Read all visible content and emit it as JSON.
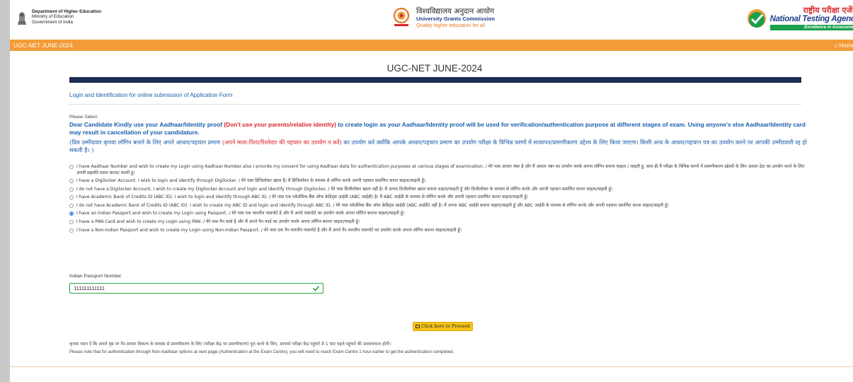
{
  "header": {
    "moe": {
      "line1": "Department of Higher Education",
      "line2": "Ministry of Education",
      "line3": "Government of India"
    },
    "ugc": {
      "hindi": "विश्वविद्यालय अनुदान आयोग",
      "english": "University Grants Commission",
      "tagline": "Quality higher education for all"
    },
    "nta": {
      "hindi": "राष्ट्रीय परीक्षा एजेंसी",
      "english": "National Testing Agency",
      "tagline": "Excellence in Assessment"
    }
  },
  "navbar": {
    "title": "UGC-NET JUNE-2024",
    "home_label": "Home",
    "bg_color": "#f39c37"
  },
  "page": {
    "title": "UGC-NET JUNE-2024",
    "section_heading": "Login and Identification for online submission of Application Form",
    "please_select": "Please Select:",
    "warning_en_1": "Dear Candidate Kindly use your Aadhaar/Identity proof",
    "warning_en_red": "(Don't use your parents/relative identity)",
    "warning_en_2": "to create login as your Aadhaar/Identity proof will be used for verification/authentication purpose at different stages of exam. Using anyone's else Aadhaar/Identity card may result in cancellation of your candidature.",
    "warning_hi_1": "(प्रिय उम्मीदवार कृपया लॉगिन बनाने के लिए अपने आधार/पहचान प्रमाण",
    "warning_hi_red": "(अपने माता-पिता/रिश्तेदार की पहचान का उपयोग न करें)",
    "warning_hi_2": "का उपयोग करें क्योंकि आपके आधार/पहचान प्रमाण का उपयोग परीक्षा के विभिन्न चरणों में सत्यापन/प्रमाणीकरण उद्देश्य के लिए किया जाएगा। किसी अन्य के आधार/पहचान पत्र का उपयोग करने पर आपकी उम्मीदवारी रद्द हो सकती है। )"
  },
  "options": [
    {
      "label": "I have Aadhaar Number and wish to create my Login using Aadhaar Number,also I provide my consent for using Aadhaar data for authentication purposes at various stages of examination. / मेरे पास आधार नंबर है और मैं आधार नंबर का उपयोग करके अपना लॉगिन बनाना चाहता / चाहती हूं, साथ ही मैं परीक्षा के विभिन्न चरणों में प्रमाणीकरण उद्देश्यों के लिए आधार डेटा का उपयोग करने के लिए अपनी सहमति प्रदान करता/ करती हूं।",
      "selected": false
    },
    {
      "label": "I have a Digilocker Account. I wish to login and identify through Digilocker. / मेरे पास डिजिलॉकर खाता है। मैं डिजिलॉकर के माध्यम से लॉगिन करके अपनी पहचान प्रमाणित करना चाहता/चाहती हूँ।",
      "selected": false
    },
    {
      "label": "I do not have a Digilocker Account. I wish to create my Digilocker Account and login and identify through Digilocker. / मेरे पास डिजीलॉकर खाता नहीं है। मैं अपना डिजीलॉकर खाता बनाना चाहता/चाहती हूँ और डिजीलॉकर के माध्यम से लॉगिन करके और अपनी पहचान प्रमाणित करना चाहता/चाहती हूँ।",
      "selected": false
    },
    {
      "label": "I have Academic Bank of Credits ID (ABC ID). I wish to login and identify through ABC ID. / मेरे पास एक एकेडेमिक बैंक ऑफ क्रेडिट्स आईडी (ABC आईडी) है। मैं ABC आईडी के माध्यम से लॉगिन करके और अपनी पहचान प्रमाणित करना चाहता/चाहती हूँ।",
      "selected": false
    },
    {
      "label": "I do not have Academic Bank of Credits ID (ABC ID). I wish to create my ABC ID and login and identify through ABC ID. / मेरे पास एकेडेमिक बैंक ऑफ क्रेडिट्स आईडी (ABC आईडी) नहीं है। मैं अपना ABC आईडी बनाना चाहता/चाहती हूँ और ABC आईडी के माध्यम से लॉगिन करके और अपनी पहचान प्रमाणित करना चाहता/चाहती हूँ।",
      "selected": false
    },
    {
      "label": "I have an Indian Passport and wish to create my Login using Passport. / मेरे पास एक भारतीय पासपोर्ट है और मैं अपने पासपोर्ट का उपयोग करके अपना लॉगिन बनाना चाहता/चाहती हूँ।",
      "selected": true
    },
    {
      "label": "I have a PAN Card and wish to create my Login using PAN. / मेरे पास पैन कार्ड है और मैं अपने पैन कार्ड का उपयोग करके अपना लॉगिन बनाना चाहता/चाहती हूँ।",
      "selected": false
    },
    {
      "label": "I have a Non-Indian Passport and wish to create my Login using Non-Indian Passport. / मेरे पास एक गैर-भारतीय पासपोर्ट है और मैं अपने गैर-भारतीय पासपोर्ट का उपयोग करके अपना लॉगिन बनाना चाहता/चाहती हूँ।",
      "selected": false
    }
  ],
  "passport": {
    "label": "Indian Passport Number",
    "value": "111111111111"
  },
  "proceed_label": "Click here to Proceed",
  "notes": {
    "hindi": "कृपया ध्यान दें कि अगले पृष्ठ पर गैर-आधार विकल्प के माध्यम से प्रमाणीकरण के लिए (परीक्षा केंद्र पर प्रमाणीकरण) पूरा करने के लिए, आपको परीक्षा केंद्र पहुंचने से 1 घंटा पहले पहुंचने की आवश्यकता होगी।",
    "english": "Please note that for authentication through Non-Aadhaar options at next page (Authentication at the Exam Centre), you will need to reach Exam Centre 1 hour earlier to get the authentication completed."
  },
  "icons": {
    "home": "home-icon",
    "check": "check-icon",
    "proceed": "login-icon"
  }
}
